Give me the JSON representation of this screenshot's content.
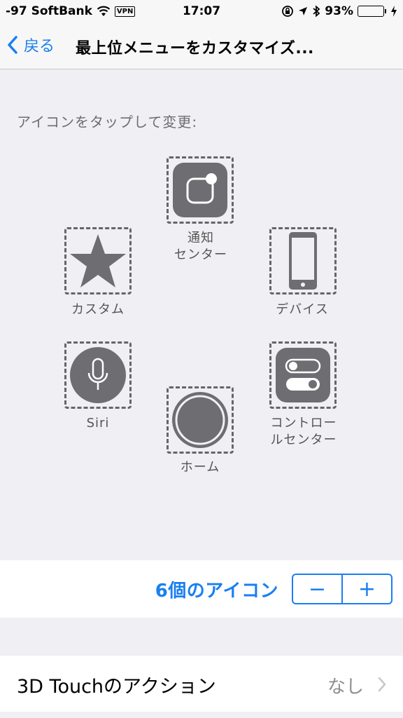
{
  "status_bar": {
    "carrier": "-97 SoftBank",
    "vpn": "VPN",
    "time": "17:07",
    "battery_percent": "93%",
    "battery_level": 0.93,
    "battery_color": "#4cd964"
  },
  "nav": {
    "back_label": "戻る",
    "title": "最上位メニューをカスタマイズ..."
  },
  "instruction": "アイコンをタップして変更:",
  "icons": {
    "notification_center": {
      "line1": "通知",
      "line2": "センター",
      "icon": "notification-center-icon"
    },
    "custom": {
      "label": "カスタム",
      "icon": "star-icon"
    },
    "device": {
      "label": "デバイス",
      "icon": "device-icon"
    },
    "siri": {
      "label": "Siri",
      "icon": "microphone-icon"
    },
    "control_center": {
      "line1": "コントロー",
      "line2": "ルセンター",
      "icon": "control-center-icon"
    },
    "home": {
      "label": "ホーム",
      "icon": "home-icon"
    }
  },
  "count": {
    "label": "6個のアイコン",
    "minus": "−",
    "plus": "+"
  },
  "touch_action": {
    "label": "3D Touchのアクション",
    "value": "なし"
  },
  "colors": {
    "accent": "#1a7ff0",
    "icon_gray": "#6d6d72",
    "background": "#efeff4"
  }
}
